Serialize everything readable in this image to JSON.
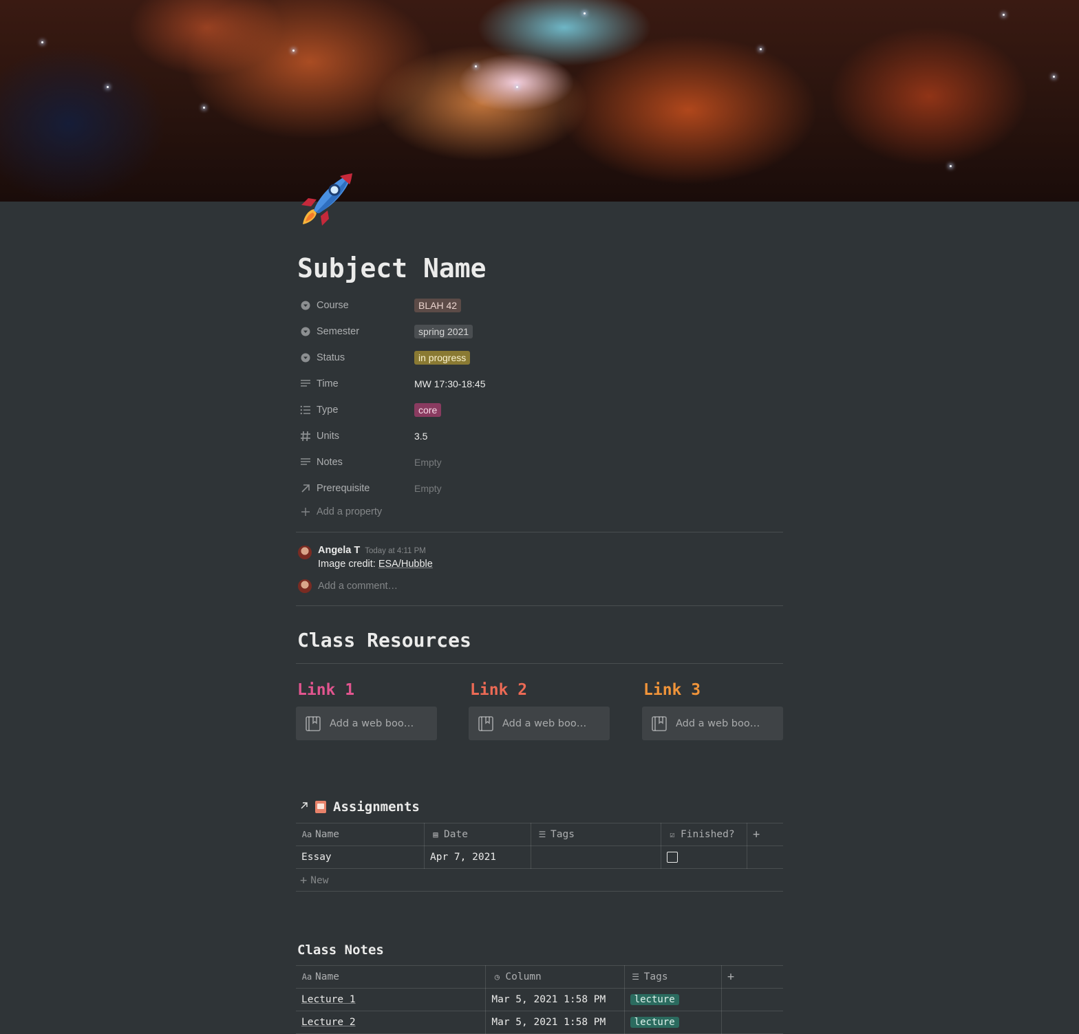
{
  "page": {
    "title": "Subject Name"
  },
  "properties": [
    {
      "icon": "select-icon",
      "name": "Course",
      "value": "BLAH 42",
      "kind": "tag",
      "bg": "#5c4b47",
      "fg": "#ebd5cf"
    },
    {
      "icon": "select-icon",
      "name": "Semester",
      "value": "spring 2021",
      "kind": "tag",
      "bg": "#4a4e51",
      "fg": "#d8d8d8"
    },
    {
      "icon": "select-icon",
      "name": "Status",
      "value": "in progress",
      "kind": "tag",
      "bg": "#8a7a33",
      "fg": "#fbf3d0"
    },
    {
      "icon": "text-icon",
      "name": "Time",
      "value": "MW 17:30-18:45",
      "kind": "text"
    },
    {
      "icon": "multiselect-icon",
      "name": "Type",
      "value": "core",
      "kind": "tag",
      "bg": "#8a3b60",
      "fg": "#f8dbe8"
    },
    {
      "icon": "number-icon",
      "name": "Units",
      "value": "3.5",
      "kind": "text"
    },
    {
      "icon": "text-icon",
      "name": "Notes",
      "value": "Empty",
      "kind": "empty"
    },
    {
      "icon": "relation-icon",
      "name": "Prerequisite",
      "value": "Empty",
      "kind": "empty"
    }
  ],
  "add_property_label": "Add a property",
  "comment": {
    "author": "Angela T",
    "time": "Today at 4:11 PM",
    "text_prefix": "Image credit: ",
    "link": "ESA/Hubble",
    "add_placeholder": "Add a comment…"
  },
  "resources": {
    "heading": "Class Resources",
    "links": [
      {
        "title": "Link 1",
        "color": "#e2558f",
        "bookmark": "Add a web boo…"
      },
      {
        "title": "Link 2",
        "color": "#ec6a55",
        "bookmark": "Add a web boo…"
      },
      {
        "title": "Link 3",
        "color": "#f0943a",
        "bookmark": "Add a web boo…"
      }
    ]
  },
  "assignments": {
    "heading": "Assignments",
    "columns": [
      "Name",
      "Date",
      "Tags",
      "Finished?"
    ],
    "rows": [
      {
        "name": "Essay",
        "date": "Apr 7, 2021",
        "tags": "",
        "finished": false
      }
    ],
    "new_label": "New"
  },
  "class_notes": {
    "heading": "Class Notes",
    "columns": [
      "Name",
      "Column",
      "Tags"
    ],
    "rows": [
      {
        "name": "Lecture 1",
        "column": "Mar 5, 2021 1:58 PM",
        "tag": "lecture"
      },
      {
        "name": "Lecture 2",
        "column": "Mar 5, 2021 1:58 PM",
        "tag": "lecture"
      }
    ]
  }
}
